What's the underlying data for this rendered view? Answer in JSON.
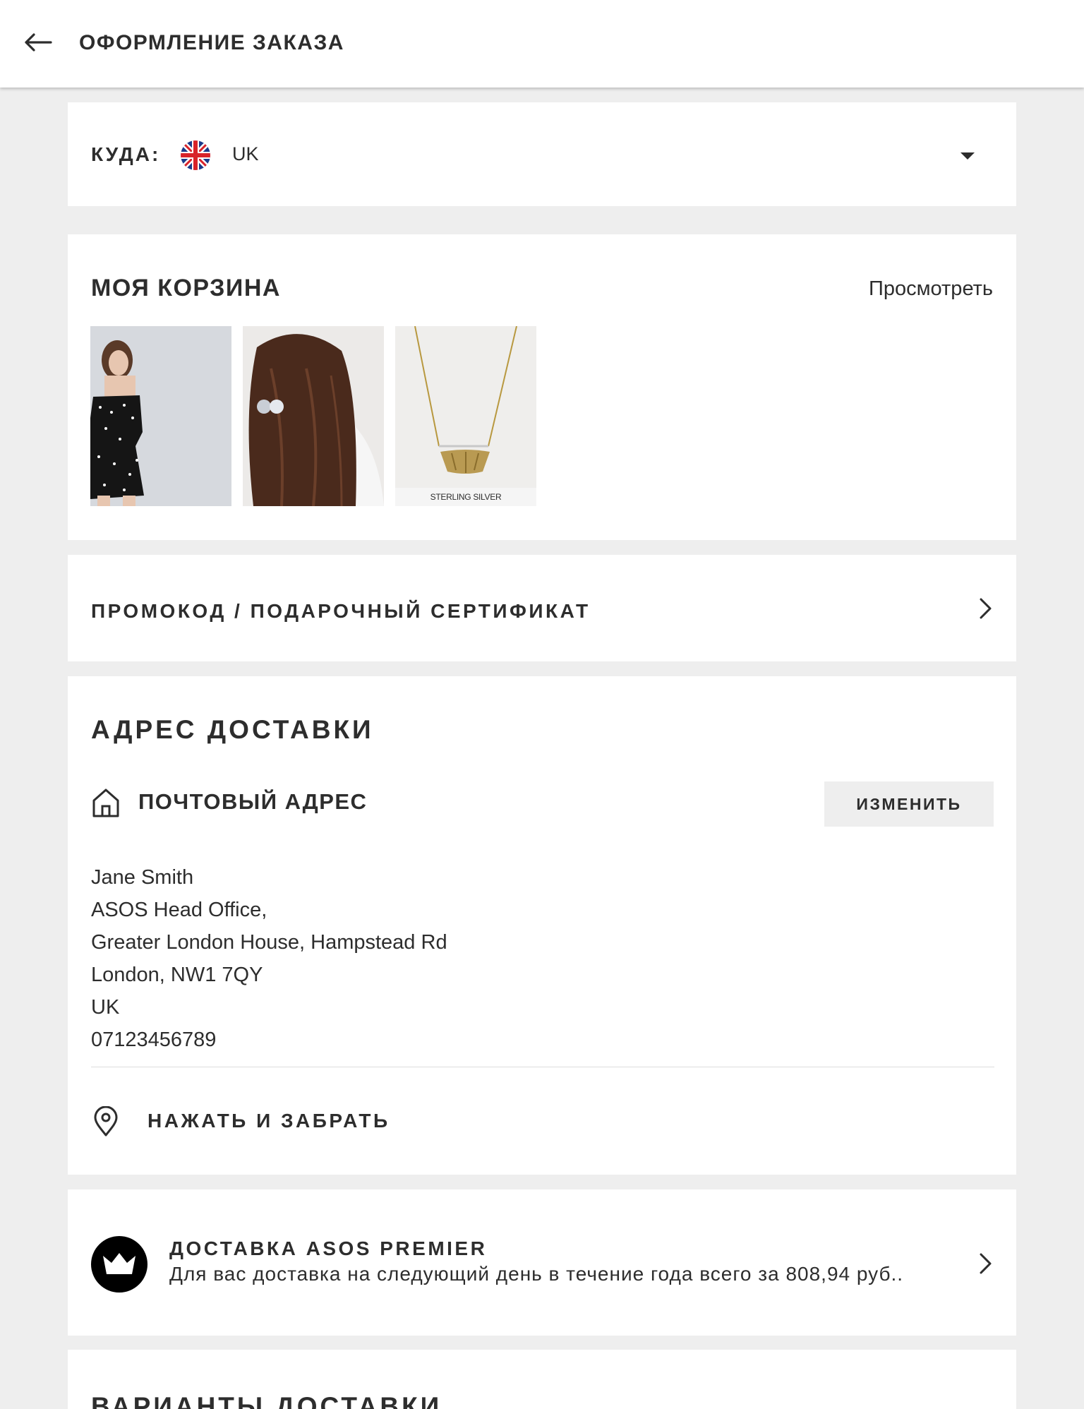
{
  "header": {
    "title": "ОФОРМЛЕНИЕ ЗАКАЗА",
    "back_icon": "arrow-left-icon"
  },
  "destination": {
    "label": "КУДА:",
    "country": "UK",
    "flag_icon": "uk-flag-icon",
    "dropdown_icon": "caret-down-icon"
  },
  "bag": {
    "title": "МОЯ КОРЗИНА",
    "view_link": "Просмотреть",
    "items": [
      {
        "name": "product-thumbnail-dress"
      },
      {
        "name": "product-thumbnail-hair-clip"
      },
      {
        "name": "product-thumbnail-necklace",
        "caption": "STERLING SILVER"
      }
    ]
  },
  "promo": {
    "label": "ПРОМОКОД / ПОДАРОЧНЫЙ СЕРТИФИКАТ"
  },
  "delivery_address": {
    "title": "АДРЕС ДОСТАВКИ",
    "type_label": "ПОЧТОВЫЙ АДРЕС",
    "edit_button": "ИЗМЕНИТЬ",
    "lines": [
      "Jane Smith",
      "ASOS Head Office,",
      "Greater London House, Hampstead Rd",
      "London, NW1 7QY",
      "UK",
      "07123456789"
    ],
    "click_collect_label": "НАЖАТЬ И ЗАБРАТЬ"
  },
  "premier": {
    "title": "ДОСТАВКА ASOS PREMIER",
    "description": "Для вас доставка на следующий день в течение года всего за 808,94 руб.."
  },
  "delivery_options": {
    "title": "ВАРИАНТЫ ДОСТАВКИ"
  },
  "colors": {
    "page_background": "#eeeeee",
    "card_background": "#ffffff",
    "text": "#2d2d2d",
    "button_background": "#eeeeee"
  }
}
